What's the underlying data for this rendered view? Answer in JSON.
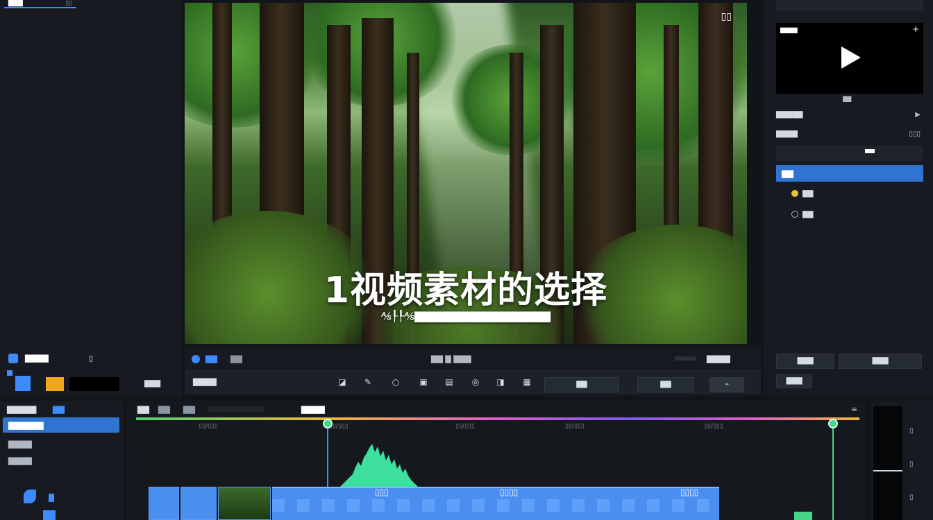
{
  "left_panel": {
    "top_tab_label": "▇▇▇",
    "top_tab_badge": "▯▯",
    "section_label": "▇▇▇▇",
    "section_badge": "▯"
  },
  "preview": {
    "title": "1视频素材的选择",
    "subtitle": "⅍┞┞⅍▇▇▇▇▇▇▇▇▇▇▇▇▇▇▇▇▇",
    "badge": "▯▯",
    "tab_active": "▇▇",
    "tab_inactive": "▇▇",
    "center_label": "▇▇ ▇ ▇▇▇",
    "right_label": "▇▇▇▇",
    "fit_label": "▇▇▇▇",
    "transform_label": "▇▇",
    "export_label": "▇▇"
  },
  "right_panel": {
    "player_caption": "▇▇▇▇",
    "player_label": "▇▇",
    "row1": "▇▇▇▇▇",
    "row2": "▇▇▇▇",
    "row2_value": "▯▯▯",
    "selected_item": "▇▇",
    "item_a": "▇▇",
    "item_b": "▇▇",
    "footer_a": "▇▇▇",
    "footer_b": "▇▇▇",
    "footer_c": "▇▇▇"
  },
  "timeline": {
    "left_header": "▇▇▇▇▇",
    "left_header_tab": "▇▇",
    "active_item": "▇▇▇▇▇▇",
    "item2": "▇▇▇▇",
    "item3": "▇▇▇▇",
    "track_tabs": [
      "▇▇",
      "▇▇",
      "▇▇"
    ],
    "track_title": "▇▇▇▇",
    "ruler": [
      "▯▯/▯▯▯",
      "▯▯/▯▯▯",
      "▯▯/▯▯▯",
      "▯▯/▯▯▯",
      "▯▯/▯▯▯"
    ],
    "clip_labels": [
      "▯▯▯",
      "▯▯▯▯",
      "▯▯▯▯"
    ]
  },
  "colors": {
    "accent": "#2f74d0",
    "playhead": "#3d8bff",
    "marker": "#46d38a",
    "waveform": "#3ee0a0"
  }
}
